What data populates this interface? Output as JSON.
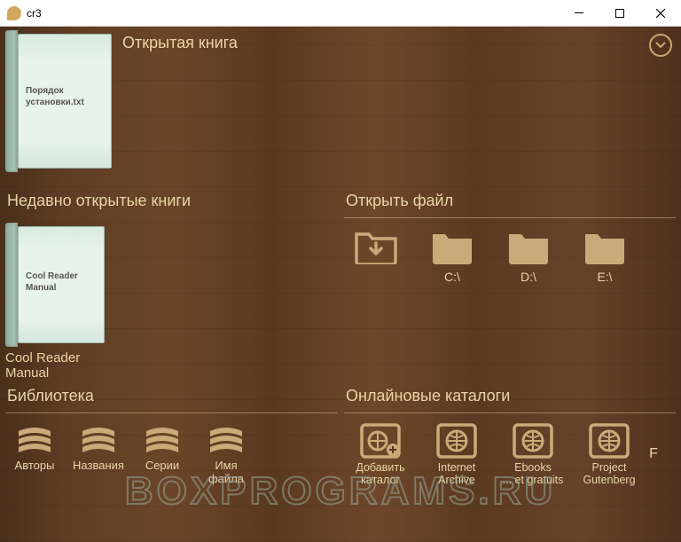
{
  "window": {
    "title": "cr3"
  },
  "open_book": {
    "heading": "Открытая книга",
    "cover_text": "Порядок установки.txt"
  },
  "recent": {
    "heading": "Недавно открытые книги",
    "items": [
      {
        "cover_text": "Cool Reader Manual",
        "caption": "Cool Reader Manual"
      }
    ]
  },
  "open_file": {
    "heading": "Открыть файл",
    "drives": [
      {
        "label": ""
      },
      {
        "label": "C:\\"
      },
      {
        "label": "D:\\"
      },
      {
        "label": "E:\\"
      }
    ]
  },
  "library": {
    "heading": "Библиотека",
    "items": [
      {
        "label": "Авторы"
      },
      {
        "label": "Названия"
      },
      {
        "label": "Серии"
      },
      {
        "label": "Имя файла"
      }
    ]
  },
  "catalogs": {
    "heading": "Онлайновые каталоги",
    "items": [
      {
        "line1": "Добавить",
        "line2": "каталог"
      },
      {
        "line1": "Internet Archive",
        "line2": ""
      },
      {
        "line1": "Ebooks",
        "line2": "... et gratuits"
      },
      {
        "line1": "Project",
        "line2": "Gutenberg"
      }
    ]
  },
  "watermark": "BOXPROGRAMS.RU"
}
